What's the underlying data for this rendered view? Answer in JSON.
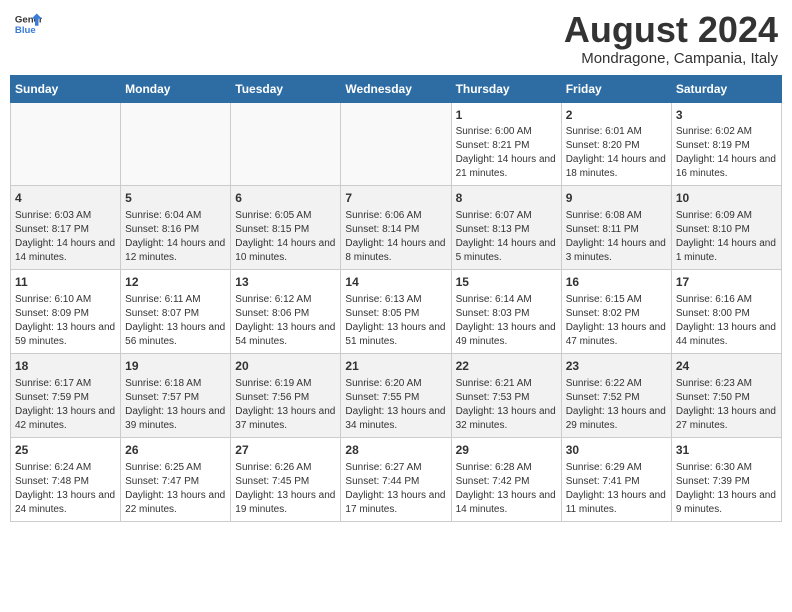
{
  "header": {
    "logo_general": "General",
    "logo_blue": "Blue",
    "month_title": "August 2024",
    "subtitle": "Mondragone, Campania, Italy"
  },
  "days_of_week": [
    "Sunday",
    "Monday",
    "Tuesday",
    "Wednesday",
    "Thursday",
    "Friday",
    "Saturday"
  ],
  "weeks": [
    [
      {
        "day": "",
        "empty": true
      },
      {
        "day": "",
        "empty": true
      },
      {
        "day": "",
        "empty": true
      },
      {
        "day": "",
        "empty": true
      },
      {
        "day": "1",
        "sunrise": "6:00 AM",
        "sunset": "8:21 PM",
        "daylight": "14 hours and 21 minutes."
      },
      {
        "day": "2",
        "sunrise": "6:01 AM",
        "sunset": "8:20 PM",
        "daylight": "14 hours and 18 minutes."
      },
      {
        "day": "3",
        "sunrise": "6:02 AM",
        "sunset": "8:19 PM",
        "daylight": "14 hours and 16 minutes."
      }
    ],
    [
      {
        "day": "4",
        "sunrise": "6:03 AM",
        "sunset": "8:17 PM",
        "daylight": "14 hours and 14 minutes."
      },
      {
        "day": "5",
        "sunrise": "6:04 AM",
        "sunset": "8:16 PM",
        "daylight": "14 hours and 12 minutes."
      },
      {
        "day": "6",
        "sunrise": "6:05 AM",
        "sunset": "8:15 PM",
        "daylight": "14 hours and 10 minutes."
      },
      {
        "day": "7",
        "sunrise": "6:06 AM",
        "sunset": "8:14 PM",
        "daylight": "14 hours and 8 minutes."
      },
      {
        "day": "8",
        "sunrise": "6:07 AM",
        "sunset": "8:13 PM",
        "daylight": "14 hours and 5 minutes."
      },
      {
        "day": "9",
        "sunrise": "6:08 AM",
        "sunset": "8:11 PM",
        "daylight": "14 hours and 3 minutes."
      },
      {
        "day": "10",
        "sunrise": "6:09 AM",
        "sunset": "8:10 PM",
        "daylight": "14 hours and 1 minute."
      }
    ],
    [
      {
        "day": "11",
        "sunrise": "6:10 AM",
        "sunset": "8:09 PM",
        "daylight": "13 hours and 59 minutes."
      },
      {
        "day": "12",
        "sunrise": "6:11 AM",
        "sunset": "8:07 PM",
        "daylight": "13 hours and 56 minutes."
      },
      {
        "day": "13",
        "sunrise": "6:12 AM",
        "sunset": "8:06 PM",
        "daylight": "13 hours and 54 minutes."
      },
      {
        "day": "14",
        "sunrise": "6:13 AM",
        "sunset": "8:05 PM",
        "daylight": "13 hours and 51 minutes."
      },
      {
        "day": "15",
        "sunrise": "6:14 AM",
        "sunset": "8:03 PM",
        "daylight": "13 hours and 49 minutes."
      },
      {
        "day": "16",
        "sunrise": "6:15 AM",
        "sunset": "8:02 PM",
        "daylight": "13 hours and 47 minutes."
      },
      {
        "day": "17",
        "sunrise": "6:16 AM",
        "sunset": "8:00 PM",
        "daylight": "13 hours and 44 minutes."
      }
    ],
    [
      {
        "day": "18",
        "sunrise": "6:17 AM",
        "sunset": "7:59 PM",
        "daylight": "13 hours and 42 minutes."
      },
      {
        "day": "19",
        "sunrise": "6:18 AM",
        "sunset": "7:57 PM",
        "daylight": "13 hours and 39 minutes."
      },
      {
        "day": "20",
        "sunrise": "6:19 AM",
        "sunset": "7:56 PM",
        "daylight": "13 hours and 37 minutes."
      },
      {
        "day": "21",
        "sunrise": "6:20 AM",
        "sunset": "7:55 PM",
        "daylight": "13 hours and 34 minutes."
      },
      {
        "day": "22",
        "sunrise": "6:21 AM",
        "sunset": "7:53 PM",
        "daylight": "13 hours and 32 minutes."
      },
      {
        "day": "23",
        "sunrise": "6:22 AM",
        "sunset": "7:52 PM",
        "daylight": "13 hours and 29 minutes."
      },
      {
        "day": "24",
        "sunrise": "6:23 AM",
        "sunset": "7:50 PM",
        "daylight": "13 hours and 27 minutes."
      }
    ],
    [
      {
        "day": "25",
        "sunrise": "6:24 AM",
        "sunset": "7:48 PM",
        "daylight": "13 hours and 24 minutes."
      },
      {
        "day": "26",
        "sunrise": "6:25 AM",
        "sunset": "7:47 PM",
        "daylight": "13 hours and 22 minutes."
      },
      {
        "day": "27",
        "sunrise": "6:26 AM",
        "sunset": "7:45 PM",
        "daylight": "13 hours and 19 minutes."
      },
      {
        "day": "28",
        "sunrise": "6:27 AM",
        "sunset": "7:44 PM",
        "daylight": "13 hours and 17 minutes."
      },
      {
        "day": "29",
        "sunrise": "6:28 AM",
        "sunset": "7:42 PM",
        "daylight": "13 hours and 14 minutes."
      },
      {
        "day": "30",
        "sunrise": "6:29 AM",
        "sunset": "7:41 PM",
        "daylight": "13 hours and 11 minutes."
      },
      {
        "day": "31",
        "sunrise": "6:30 AM",
        "sunset": "7:39 PM",
        "daylight": "13 hours and 9 minutes."
      }
    ]
  ],
  "labels": {
    "sunrise": "Sunrise:",
    "sunset": "Sunset:",
    "daylight": "Daylight:"
  }
}
